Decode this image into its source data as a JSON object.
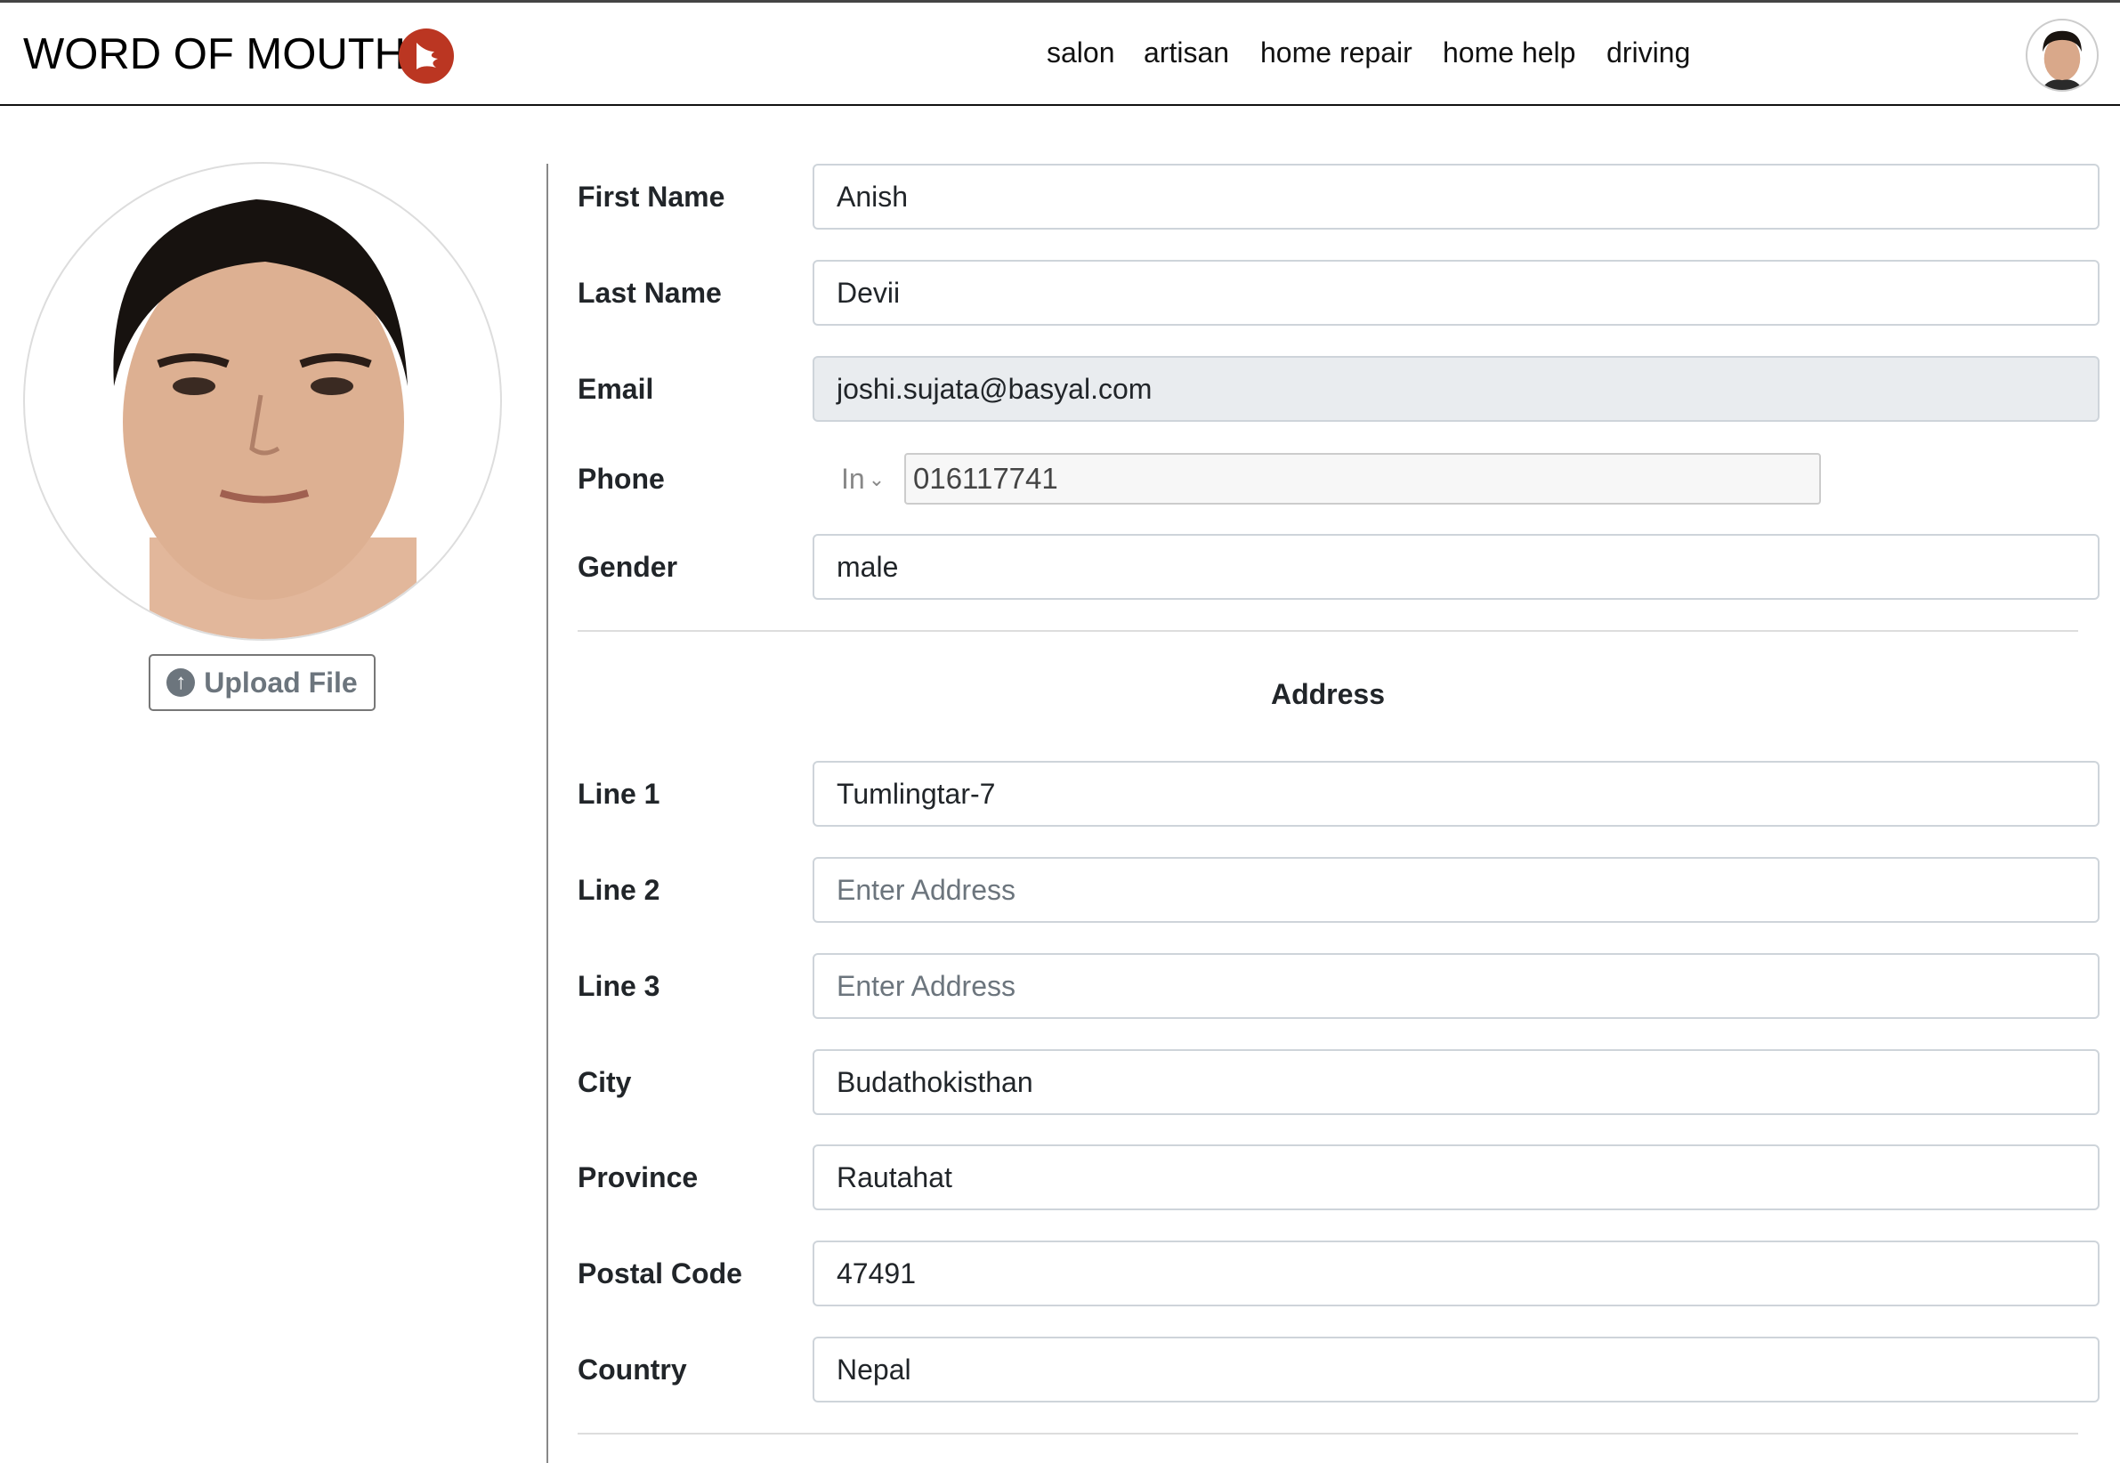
{
  "header": {
    "brand": "WORD OF MOUTH",
    "nav": [
      "salon",
      "artisan",
      "home repair",
      "home help",
      "driving"
    ],
    "accent": "#bb3622"
  },
  "profile": {
    "upload_label": "Upload File",
    "upload_icon": "arrow-up-circle-icon"
  },
  "form": {
    "first_name": {
      "label": "First Name",
      "value": "Anish"
    },
    "last_name": {
      "label": "Last Name",
      "value": "Devii"
    },
    "email": {
      "label": "Email",
      "value": "joshi.sujata@basyal.com"
    },
    "phone": {
      "label": "Phone",
      "country": "In",
      "value": "016117741"
    },
    "gender": {
      "label": "Gender",
      "value": "male"
    },
    "address_heading": "Address",
    "line1": {
      "label": "Line 1",
      "value": "Tumlingtar-7"
    },
    "line2": {
      "label": "Line 2",
      "placeholder": "Enter Address"
    },
    "line3": {
      "label": "Line 3",
      "placeholder": "Enter Address"
    },
    "city": {
      "label": "City",
      "value": "Budathokisthan"
    },
    "province": {
      "label": "Province",
      "value": "Rautahat"
    },
    "postal": {
      "label": "Postal Code",
      "value": "47491"
    },
    "country": {
      "label": "Country",
      "value": "Nepal"
    }
  }
}
